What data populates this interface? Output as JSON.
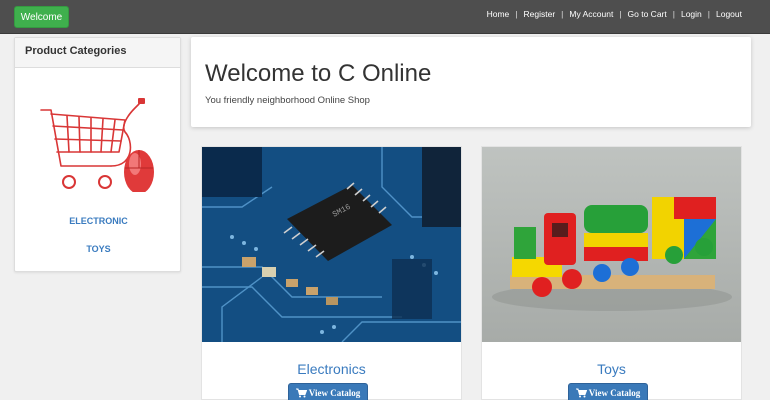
{
  "topbar": {
    "welcome_label": "Welcome",
    "nav": [
      {
        "label": "Home"
      },
      {
        "label": "Register"
      },
      {
        "label": "My Account"
      },
      {
        "label": "Go to Cart"
      },
      {
        "label": "Login"
      },
      {
        "label": "Logout"
      }
    ]
  },
  "sidebar": {
    "heading": "Product Categories",
    "image_icon": "cart-mouse-icon",
    "categories": [
      {
        "label": "ELECTRONIC"
      },
      {
        "label": "TOYS"
      }
    ]
  },
  "jumbotron": {
    "title": "Welcome to C Online",
    "subtitle": "You friendly neighborhood Online Shop"
  },
  "products": [
    {
      "title": "Electronics",
      "button_label": "View Catalog",
      "image": "circuit-board"
    },
    {
      "title": "Toys",
      "button_label": "View Catalog",
      "image": "toy-train"
    }
  ],
  "colors": {
    "topbar": "#4e4e4e",
    "welcome_button": "#3fb04d",
    "link": "#3a7bbf",
    "primary_button": "#3a79b8"
  }
}
